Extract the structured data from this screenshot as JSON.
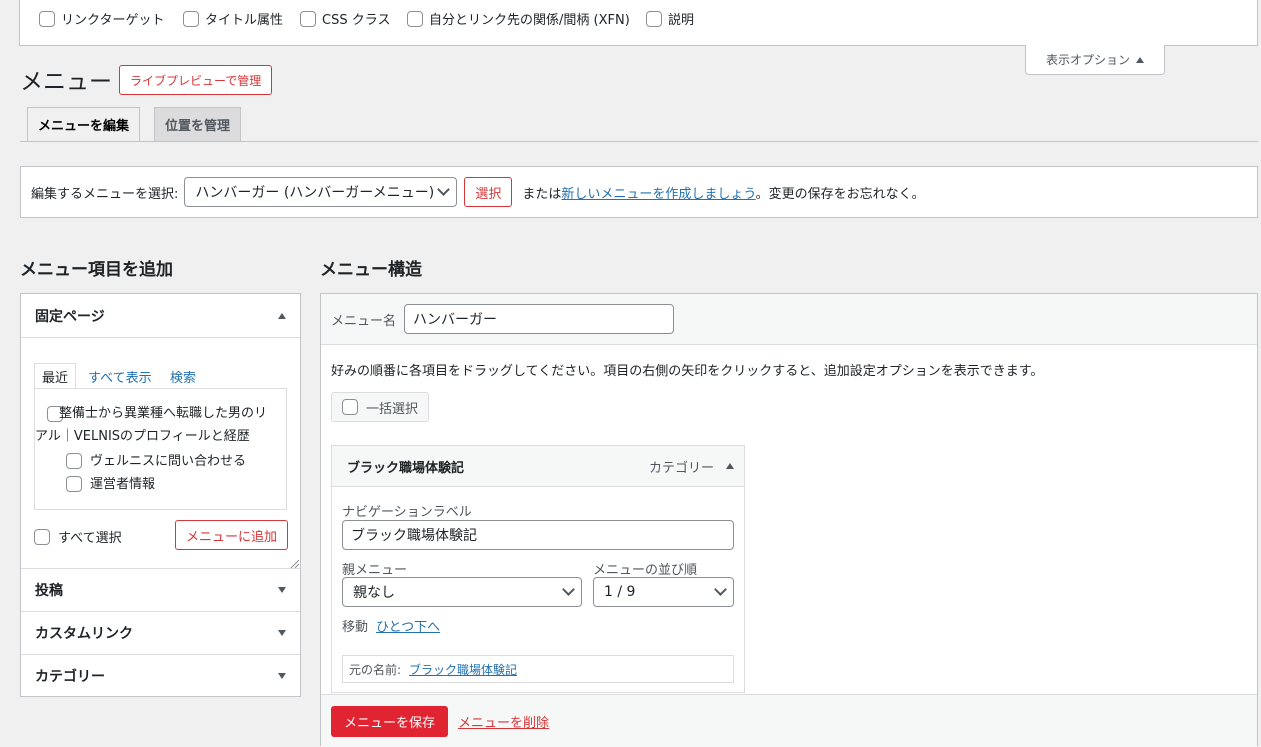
{
  "screen_options": {
    "items": [
      {
        "label": "リンクターゲット",
        "checked": false
      },
      {
        "label": "タイトル属性",
        "checked": false
      },
      {
        "label": "CSS クラス",
        "checked": false
      },
      {
        "label": "自分とリンク先の関係/間柄 (XFN)",
        "checked": false
      },
      {
        "label": "説明",
        "checked": false
      }
    ],
    "tab_label": "表示オプション"
  },
  "header": {
    "title": "メニュー",
    "live_preview_label": "ライブプレビューで管理"
  },
  "tabs": [
    {
      "label": "メニューを編集",
      "active": true
    },
    {
      "label": "位置を管理",
      "active": false
    }
  ],
  "select_bar": {
    "label": "編集するメニューを選択:",
    "selected_menu": "ハンバーガー (ハンバーガーメニュー)",
    "select_button": "選択",
    "or_text": "または",
    "create_link": "新しいメニューを作成しましょう",
    "suffix_text": "。変更の保存をお忘れなく。"
  },
  "add_items": {
    "title": "メニュー項目を追加",
    "pages": {
      "title": "固定ページ",
      "tabs": [
        "最近",
        "すべて表示",
        "検索"
      ],
      "items": [
        {
          "label": "整備士から異業種へ転職した男のリアル｜VELNISのプロフィールと経歴",
          "checked": false
        },
        {
          "label": "ヴェルニスに問い合わせる",
          "checked": false
        },
        {
          "label": "運営者情報",
          "checked": false
        }
      ],
      "select_all": "すべて選択",
      "add_button": "メニューに追加"
    },
    "accordions": [
      "投稿",
      "カスタムリンク",
      "カテゴリー"
    ]
  },
  "structure": {
    "title": "メニュー構造",
    "name_label": "メニュー名",
    "name_value": "ハンバーガー",
    "instructions": "好みの順番に各項目をドラッグしてください。項目の右側の矢印をクリックすると、追加設定オプションを表示できます。",
    "bulk_select": "一括選択",
    "item": {
      "title": "ブラック職場体験記",
      "type": "カテゴリー",
      "nav_label_caption": "ナビゲーションラベル",
      "nav_label_value": "ブラック職場体験記",
      "parent_caption": "親メニュー",
      "parent_value": "親なし",
      "order_caption": "メニューの並び順",
      "order_value": "1 / 9",
      "move_caption": "移動",
      "move_link": "ひとつ下へ",
      "original_caption": "元の名前:",
      "original_link": "ブラック職場体験記"
    },
    "save_button": "メニューを保存",
    "delete_link": "メニューを削除"
  },
  "colors": {
    "accent_red": "#d63638",
    "save_red": "#e02432",
    "link_blue": "#2271b1"
  }
}
